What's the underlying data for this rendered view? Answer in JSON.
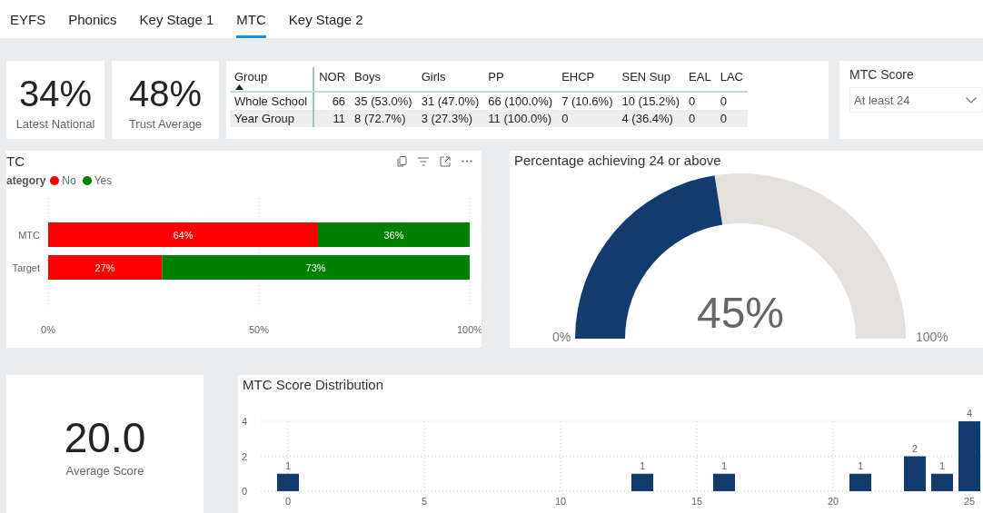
{
  "tabs": [
    {
      "label": "EYFS",
      "selected": false
    },
    {
      "label": "Phonics",
      "selected": false
    },
    {
      "label": "Key Stage 1",
      "selected": false
    },
    {
      "label": "MTC",
      "selected": true
    },
    {
      "label": "Key Stage 2",
      "selected": false
    }
  ],
  "kpis": [
    {
      "value": "34%",
      "label": "Latest National"
    },
    {
      "value": "48%",
      "label": "Trust Average"
    }
  ],
  "table": {
    "columns": [
      {
        "label": "Group",
        "sorted": true
      },
      {
        "label": "NOR",
        "sorted": false
      },
      {
        "label": "Boys",
        "sorted": false
      },
      {
        "label": "Girls",
        "sorted": false
      },
      {
        "label": "PP",
        "sorted": false
      },
      {
        "label": "EHCP",
        "sorted": false
      },
      {
        "label": "SEN Sup",
        "sorted": false
      },
      {
        "label": "EAL",
        "sorted": false
      },
      {
        "label": "LAC",
        "sorted": false
      }
    ],
    "rows": [
      [
        "Whole School",
        "66",
        "35 (53.0%)",
        "31 (47.0%)",
        "66 (100.0%)",
        "7 (10.6%)",
        "10 (15.2%)",
        "0",
        "0"
      ],
      [
        "Year Group",
        "11",
        "8 (72.7%)",
        "3 (27.3%)",
        "11 (100.0%)",
        "0",
        "4 (36.4%)",
        "0",
        "0"
      ]
    ]
  },
  "slicer": {
    "title": "MTC Score",
    "value": "At least 24"
  },
  "mtc_card": {
    "title": "TC",
    "legend_title": "ategory",
    "chart_data": {
      "type": "bar",
      "orientation": "horizontal",
      "stacked": true,
      "categories": [
        "MTC",
        "Target"
      ],
      "series": [
        {
          "name": "No",
          "color": "#ff0000",
          "values": [
            64,
            27
          ],
          "value_labels": [
            "64%",
            "27%"
          ]
        },
        {
          "name": "Yes",
          "color": "#008000",
          "values": [
            36,
            73
          ],
          "value_labels": [
            "36%",
            "73%"
          ]
        }
      ],
      "xlim": [
        0,
        100
      ],
      "xticks": [
        {
          "value": 0,
          "label": "0%"
        },
        {
          "value": 50,
          "label": "50%"
        },
        {
          "value": 100,
          "label": "100%"
        }
      ],
      "data_labels": true
    }
  },
  "gauge": {
    "title": "Percentage achieving 24 or above",
    "value": "45%",
    "min_label": "0%",
    "max_label": "100%"
  },
  "average": {
    "value": "20.0",
    "label": "Average Score"
  },
  "distribution": {
    "title": "MTC Score Distribution",
    "chart_data": {
      "type": "bar",
      "x": [
        0,
        13,
        16,
        21,
        23,
        24,
        25
      ],
      "series": [
        {
          "color": "#123c6e",
          "values": [
            1,
            1,
            1,
            1,
            2,
            1,
            4
          ]
        }
      ],
      "xlim": [
        -1,
        25.5
      ],
      "ylim": [
        0,
        4
      ],
      "xticks": [
        0,
        5,
        10,
        15,
        20,
        25
      ],
      "yticks": [
        0,
        2,
        4
      ],
      "grid": true,
      "data_labels": true
    }
  }
}
